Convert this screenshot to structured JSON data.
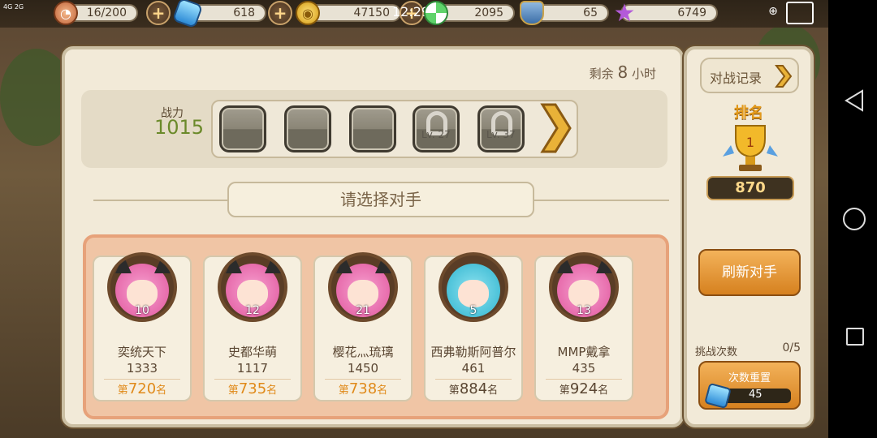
{
  "status_bar": {
    "signal_text": "4G 2G",
    "time": "12:29"
  },
  "top_bar": {
    "stamina": "16/200",
    "diamonds": "618",
    "gold": "47150",
    "candy": "2095",
    "honor": "65",
    "stars": "6749"
  },
  "main": {
    "remaining_prefix": "剩余",
    "remaining_value": "8",
    "remaining_suffix": "小时",
    "power_label": "战力",
    "power_value": "1015",
    "locked_slots": [
      "Lv. 27",
      "Lv. 37"
    ],
    "select_title": "请选择对手",
    "opponents": [
      {
        "level": "10",
        "name": "奕统天下",
        "power": "1333",
        "rank_prefix": "第",
        "rank": "720",
        "rank_suffix": "名"
      },
      {
        "level": "12",
        "name": "史都华萌",
        "power": "1117",
        "rank_prefix": "第",
        "rank": "735",
        "rank_suffix": "名"
      },
      {
        "level": "21",
        "name": "樱花灬琉璃",
        "power": "1450",
        "rank_prefix": "第",
        "rank": "738",
        "rank_suffix": "名"
      },
      {
        "level": "5",
        "name": "西弗勒斯阿普尔",
        "power": "461",
        "rank_prefix": "第",
        "rank": "884",
        "rank_suffix": "名"
      },
      {
        "level": "13",
        "name": "MMP戴拿",
        "power": "435",
        "rank_prefix": "第",
        "rank": "924",
        "rank_suffix": "名"
      }
    ]
  },
  "side": {
    "record_label": "对战记录",
    "rank_title": "排名",
    "rank_value": "870",
    "refresh_label": "刷新对手",
    "challenge_label": "挑战次数",
    "challenge_count": "0/5",
    "reset_label": "次数重置",
    "reset_cost": "45"
  },
  "colors": {
    "accent_orange": "#e08a1a",
    "power_green": "#6b8a2a",
    "panel_bg": "#f2ead8",
    "opponent_area": "#f0c5a5"
  }
}
